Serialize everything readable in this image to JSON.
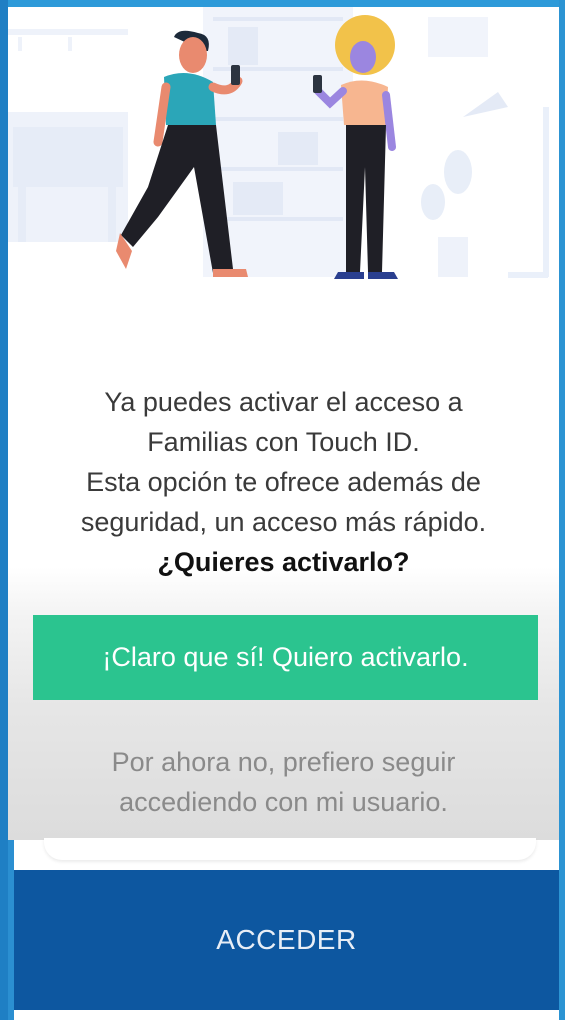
{
  "prompt": {
    "lines": [
      "Ya puedes activar el acceso a",
      "Familias con Touch ID.",
      "Esta opción te ofrece además de",
      "seguridad, un acceso más rápido."
    ],
    "question": "¿Quieres activarlo?"
  },
  "actions": {
    "confirm_label": "¡Claro que sí! Quiero activarlo.",
    "decline_lines": [
      "Por ahora no, prefiero seguir",
      "accediendo con mi usuario."
    ],
    "access_label": "ACCEDER"
  },
  "colors": {
    "confirm": "#2bc48f",
    "access": "#0d57a0",
    "frame": "#2b8fd1"
  },
  "icons": [
    "people-illustration"
  ]
}
